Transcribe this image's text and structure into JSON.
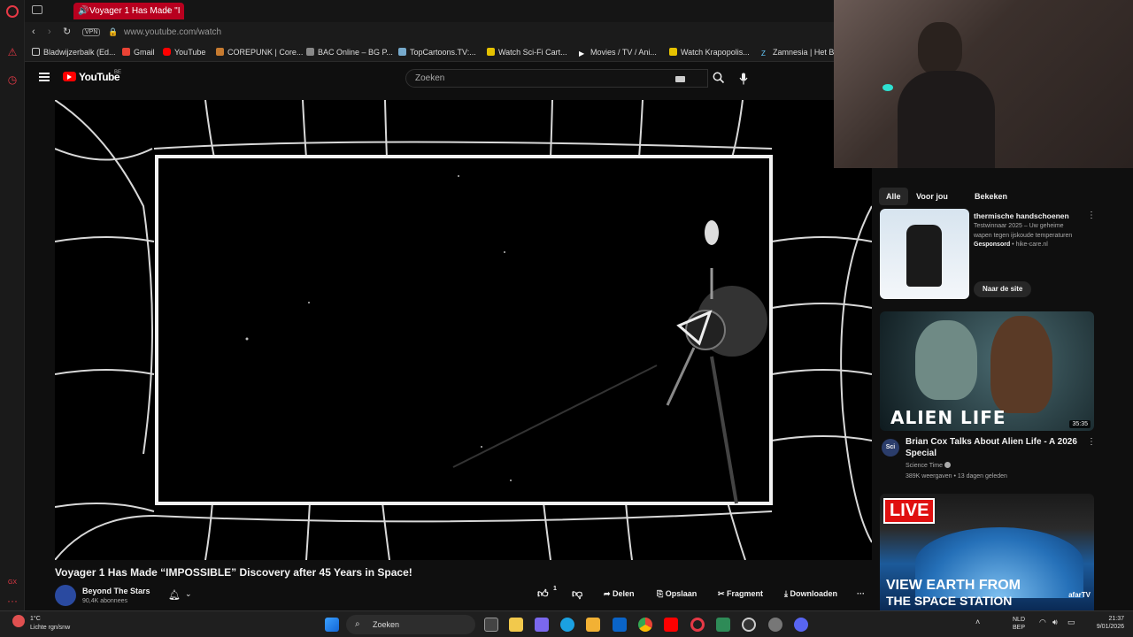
{
  "browser": {
    "tab_title": "Voyager 1 Has Made \"I",
    "url": "www.youtube.com/watch",
    "vpn_label": "VPN",
    "bookmarks": [
      {
        "label": "Bladwijzerbalk (Ed...",
        "icon": "folder-icon"
      },
      {
        "label": "Gmail",
        "icon": "gmail-icon"
      },
      {
        "label": "YouTube",
        "icon": "youtube-icon"
      },
      {
        "label": "COREPUNK | Core...",
        "icon": "corepunk-icon"
      },
      {
        "label": "BAC Online – BG P...",
        "icon": "bac-icon"
      },
      {
        "label": "TopCartoons.TV:...",
        "icon": "topcartoons-icon"
      },
      {
        "label": "Watch Sci-Fi Cart...",
        "icon": "scifi-icon"
      },
      {
        "label": "Movies / TV / Ani...",
        "icon": "play-icon"
      },
      {
        "label": "Watch Krapopolis...",
        "icon": "krapopolis-icon"
      },
      {
        "label": "Zamnesia | Het Be",
        "icon": "zamnesia-icon"
      }
    ]
  },
  "youtube": {
    "logo_text": "YouTube",
    "region": "BE",
    "search_placeholder": "Zoeken"
  },
  "video": {
    "title": "Voyager 1 Has Made “IMPOSSIBLE” Discovery after 45 Years in Space!",
    "channel": "Beyond The Stars",
    "subscribers": "90,4K abonnees",
    "like_count": "1",
    "actions": {
      "share": "Delen",
      "save": "Opslaan",
      "clip": "Fragment",
      "download": "Downloaden"
    }
  },
  "sidebar": {
    "chips": [
      "Alle",
      "Voor jou",
      "Bekeken"
    ],
    "ad": {
      "title": "thermische handschoenen",
      "description": "Testwinnaar 2025 – Uw geheime wapen tegen ijskoude temperaturen",
      "sponsored": "Gesponsord",
      "domain": "hike-care.nl",
      "cta": "Naar de site"
    },
    "videos": [
      {
        "thumb_text": "ALIEN LIFE",
        "duration": "35:35",
        "title": "Brian Cox Talks About Alien Life - A 2026 Special",
        "channel": "Science Time",
        "channel_avatar": "Sci",
        "meta": "389K weergaven • 13 dagen geleden"
      },
      {
        "live_badge": "LIVE",
        "thumb_line1": "VIEW EARTH FROM",
        "thumb_line2": "THE SPACE STATION",
        "corner_brand": "afarTV"
      }
    ]
  },
  "taskbar": {
    "weather_temp": "1°C",
    "weather_text": "Lichte rgn/snw",
    "search_placeholder": "Zoeken",
    "lang_line1": "NLD",
    "lang_line2": "BEP",
    "time": "21:37",
    "date": "9/01/2026"
  },
  "colors": {
    "accent": "#b8001f",
    "youtube_red": "#ff0000",
    "background": "#0f0f0f"
  }
}
